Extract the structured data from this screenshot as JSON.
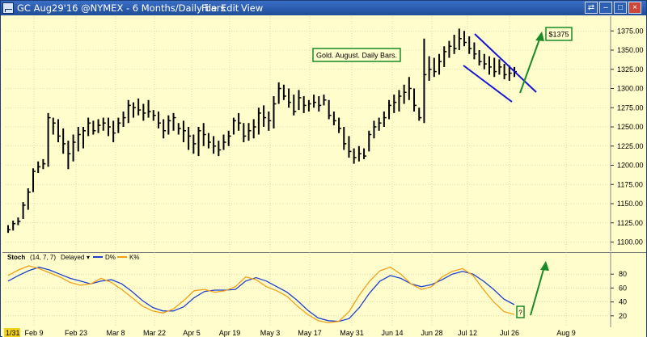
{
  "window": {
    "title": "GC Aug29'16 @NYMEX - 6 Months/Daily bars",
    "menu": [
      "File",
      "Edit",
      "View"
    ],
    "controls": [
      "⇄",
      "–",
      "□",
      "×"
    ]
  },
  "annotations": {
    "gold_label": "Gold. August. Daily Bars.",
    "target_price": "$1375",
    "question": "?"
  },
  "colors": {
    "background": "#fffdcb",
    "bars": "#000000",
    "channel": "#1515d6",
    "arrow": "#1a8a2a",
    "d_line": "#1f3fcf",
    "k_line": "#f0a11a",
    "box_border": "#1a8a2a"
  },
  "stoch_legend": {
    "name": "Stoch",
    "params": "(14, 7, 7)",
    "mode": "Delayed",
    "d": "D%",
    "k": "K%"
  },
  "chart_data": [
    {
      "type": "bar",
      "title": "GC Aug29'16 @NYMEX - 6 Months/Daily bars",
      "x_labels": [
        "1/31",
        "Feb 9",
        "Feb 23",
        "Mar 8",
        "Mar 22",
        "Apr 5",
        "Apr 19",
        "May 3",
        "May 17",
        "May 31",
        "Jun 14",
        "Jun 28",
        "Jul 12",
        "Jul 26",
        "Aug 9"
      ],
      "y_ticks": [
        1100,
        1125,
        1150,
        1175,
        1200,
        1225,
        1250,
        1275,
        1300,
        1325,
        1350,
        1375
      ],
      "ylim": [
        1090,
        1390
      ],
      "grid": true,
      "series": [
        {
          "values": [
            [
              1112,
              1122,
              1116
            ],
            [
              1115,
              1128,
              1124
            ],
            [
              1122,
              1132,
              1127
            ],
            [
              1130,
              1152,
              1148
            ],
            [
              1142,
              1170,
              1165
            ],
            [
              1165,
              1196,
              1192
            ],
            [
              1190,
              1205,
              1198
            ],
            [
              1195,
              1208,
              1202
            ],
            [
              1198,
              1268,
              1262
            ],
            [
              1240,
              1262,
              1255
            ],
            [
              1230,
              1260,
              1238
            ],
            [
              1215,
              1248,
              1228
            ],
            [
              1195,
              1232,
              1215
            ],
            [
              1205,
              1240,
              1230
            ],
            [
              1218,
              1250,
              1240
            ],
            [
              1222,
              1250,
              1245
            ],
            [
              1238,
              1262,
              1255
            ],
            [
              1240,
              1258,
              1245
            ],
            [
              1242,
              1260,
              1252
            ],
            [
              1245,
              1262,
              1255
            ],
            [
              1238,
              1262,
              1250
            ],
            [
              1230,
              1258,
              1242
            ],
            [
              1242,
              1262,
              1255
            ],
            [
              1250,
              1270,
              1262
            ],
            [
              1255,
              1285,
              1278
            ],
            [
              1262,
              1282,
              1275
            ],
            [
              1265,
              1287,
              1272
            ],
            [
              1258,
              1280,
              1268
            ],
            [
              1262,
              1285,
              1270
            ],
            [
              1258,
              1272,
              1265
            ],
            [
              1248,
              1270,
              1255
            ],
            [
              1235,
              1260,
              1245
            ],
            [
              1240,
              1265,
              1258
            ],
            [
              1245,
              1268,
              1262
            ],
            [
              1240,
              1255,
              1248
            ],
            [
              1230,
              1258,
              1245
            ],
            [
              1220,
              1250,
              1238
            ],
            [
              1215,
              1240,
              1228
            ],
            [
              1212,
              1250,
              1245
            ],
            [
              1225,
              1255,
              1240
            ],
            [
              1222,
              1242,
              1230
            ],
            [
              1215,
              1238,
              1225
            ],
            [
              1212,
              1232,
              1220
            ],
            [
              1220,
              1240,
              1230
            ],
            [
              1225,
              1245,
              1238
            ],
            [
              1240,
              1262,
              1258
            ],
            [
              1245,
              1268,
              1255
            ],
            [
              1230,
              1255,
              1238
            ],
            [
              1232,
              1255,
              1245
            ],
            [
              1235,
              1260,
              1250
            ],
            [
              1240,
              1275,
              1268
            ],
            [
              1250,
              1278,
              1262
            ],
            [
              1245,
              1270,
              1258
            ],
            [
              1248,
              1290,
              1280
            ],
            [
              1280,
              1308,
              1300
            ],
            [
              1285,
              1305,
              1290
            ],
            [
              1275,
              1300,
              1282
            ],
            [
              1265,
              1292,
              1270
            ],
            [
              1272,
              1298,
              1288
            ],
            [
              1268,
              1290,
              1278
            ],
            [
              1270,
              1285,
              1280
            ],
            [
              1275,
              1292,
              1282
            ],
            [
              1270,
              1290,
              1278
            ],
            [
              1278,
              1292,
              1285
            ],
            [
              1260,
              1285,
              1265
            ],
            [
              1252,
              1270,
              1258
            ],
            [
              1242,
              1262,
              1248
            ],
            [
              1220,
              1250,
              1228
            ],
            [
              1210,
              1238,
              1218
            ],
            [
              1202,
              1222,
              1210
            ],
            [
              1205,
              1225,
              1215
            ],
            [
              1208,
              1222,
              1212
            ],
            [
              1218,
              1245,
              1240
            ],
            [
              1235,
              1258,
              1250
            ],
            [
              1245,
              1262,
              1255
            ],
            [
              1250,
              1270,
              1262
            ],
            [
              1260,
              1285,
              1278
            ],
            [
              1268,
              1292,
              1282
            ],
            [
              1270,
              1298,
              1290
            ],
            [
              1280,
              1305,
              1295
            ],
            [
              1285,
              1315,
              1300
            ],
            [
              1270,
              1300,
              1278
            ],
            [
              1258,
              1275,
              1262
            ],
            [
              1255,
              1365,
              1318
            ],
            [
              1310,
              1342,
              1325
            ],
            [
              1315,
              1340,
              1322
            ],
            [
              1318,
              1345,
              1335
            ],
            [
              1328,
              1355,
              1348
            ],
            [
              1340,
              1362,
              1355
            ],
            [
              1345,
              1370,
              1352
            ],
            [
              1350,
              1378,
              1365
            ],
            [
              1355,
              1375,
              1360
            ],
            [
              1345,
              1368,
              1352
            ],
            [
              1338,
              1360,
              1345
            ],
            [
              1330,
              1350,
              1335
            ],
            [
              1325,
              1345,
              1332
            ],
            [
              1318,
              1342,
              1328
            ],
            [
              1315,
              1340,
              1322
            ],
            [
              1318,
              1338,
              1328
            ],
            [
              1312,
              1332,
              1318
            ],
            [
              1310,
              1330,
              1320
            ],
            [
              1315,
              1328,
              1322
            ]
          ]
        }
      ]
    },
    {
      "type": "line",
      "title": "Stoch (14, 7, 7) Delayed",
      "y_ticks": [
        20,
        40,
        60,
        80
      ],
      "ylim": [
        0,
        100
      ],
      "series": [
        {
          "name": "D%",
          "values": [
            [
              0,
              70
            ],
            [
              6,
              78
            ],
            [
              12,
              85
            ],
            [
              18,
              90
            ],
            [
              24,
              86
            ],
            [
              30,
              80
            ],
            [
              36,
              74
            ],
            [
              42,
              70
            ],
            [
              48,
              66
            ],
            [
              54,
              70
            ],
            [
              60,
              72
            ],
            [
              66,
              66
            ],
            [
              72,
              55
            ],
            [
              78,
              42
            ],
            [
              84,
              32
            ],
            [
              90,
              27
            ],
            [
              96,
              27
            ],
            [
              102,
              33
            ],
            [
              108,
              46
            ],
            [
              114,
              55
            ],
            [
              120,
              57
            ],
            [
              126,
              57
            ],
            [
              132,
              58
            ],
            [
              138,
              70
            ],
            [
              144,
              75
            ],
            [
              150,
              70
            ],
            [
              156,
              62
            ],
            [
              162,
              54
            ],
            [
              168,
              42
            ],
            [
              174,
              28
            ],
            [
              180,
              17
            ],
            [
              186,
              13
            ],
            [
              192,
              12
            ],
            [
              198,
              16
            ],
            [
              204,
              32
            ],
            [
              210,
              53
            ],
            [
              216,
              70
            ],
            [
              222,
              78
            ],
            [
              228,
              74
            ],
            [
              234,
              66
            ],
            [
              240,
              62
            ],
            [
              246,
              65
            ],
            [
              252,
              72
            ],
            [
              258,
              80
            ],
            [
              264,
              84
            ],
            [
              270,
              80
            ],
            [
              276,
              70
            ],
            [
              282,
              58
            ],
            [
              288,
              44
            ],
            [
              294,
              36
            ]
          ]
        },
        {
          "name": "K%",
          "values": [
            [
              0,
              78
            ],
            [
              6,
              86
            ],
            [
              12,
              92
            ],
            [
              18,
              88
            ],
            [
              24,
              82
            ],
            [
              30,
              76
            ],
            [
              36,
              68
            ],
            [
              42,
              64
            ],
            [
              48,
              66
            ],
            [
              54,
              74
            ],
            [
              60,
              68
            ],
            [
              66,
              58
            ],
            [
              72,
              46
            ],
            [
              78,
              34
            ],
            [
              84,
              27
            ],
            [
              90,
              24
            ],
            [
              96,
              30
            ],
            [
              102,
              42
            ],
            [
              108,
              56
            ],
            [
              114,
              58
            ],
            [
              120,
              54
            ],
            [
              126,
              56
            ],
            [
              132,
              62
            ],
            [
              138,
              76
            ],
            [
              144,
              72
            ],
            [
              150,
              62
            ],
            [
              156,
              56
            ],
            [
              162,
              48
            ],
            [
              168,
              34
            ],
            [
              174,
              22
            ],
            [
              180,
              13
            ],
            [
              186,
              10
            ],
            [
              192,
              12
            ],
            [
              198,
              26
            ],
            [
              204,
              50
            ],
            [
              210,
              70
            ],
            [
              216,
              85
            ],
            [
              222,
              90
            ],
            [
              228,
              80
            ],
            [
              234,
              66
            ],
            [
              240,
              58
            ],
            [
              246,
              62
            ],
            [
              252,
              76
            ],
            [
              258,
              84
            ],
            [
              264,
              88
            ],
            [
              270,
              78
            ],
            [
              276,
              58
            ],
            [
              282,
              40
            ],
            [
              288,
              26
            ],
            [
              294,
              22
            ]
          ]
        }
      ]
    }
  ]
}
